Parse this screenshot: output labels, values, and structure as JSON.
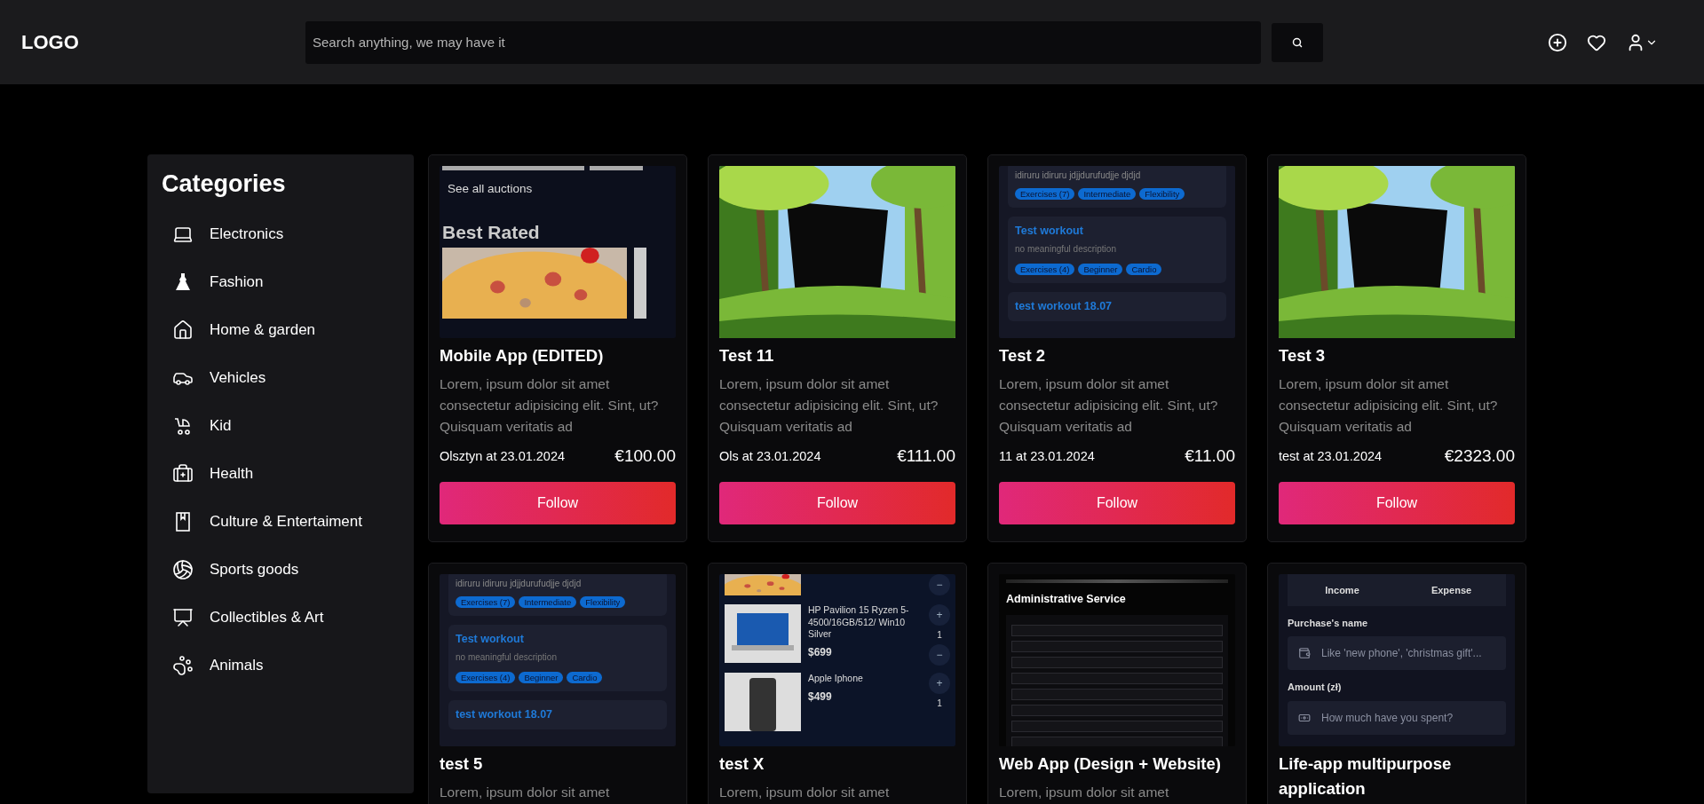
{
  "header": {
    "logo": "LOGO",
    "search": {
      "placeholder": "Search anything, we may have it"
    }
  },
  "sidebar": {
    "title": "Categories",
    "items": [
      {
        "label": "Electronics"
      },
      {
        "label": "Fashion"
      },
      {
        "label": "Home & garden"
      },
      {
        "label": "Vehicles"
      },
      {
        "label": "Kid"
      },
      {
        "label": "Health"
      },
      {
        "label": "Culture & Entertaiment"
      },
      {
        "label": "Sports goods"
      },
      {
        "label": "Collectibles & Art"
      },
      {
        "label": "Animals"
      }
    ]
  },
  "cards": [
    {
      "thumb": {
        "kind": "auction",
        "link": "See all auctions",
        "heading": "Best Rated"
      },
      "title": "Mobile App (EDITED)",
      "description": "Lorem, ipsum dolor sit amet consectetur adipisicing elit. Sint, ut? Quisquam veritatis ad",
      "place": "Olsztyn at 23.01.2024",
      "price": "€100.00",
      "action": "Follow"
    },
    {
      "title": "Test 11",
      "description": "Lorem, ipsum dolor sit amet consectetur adipisicing elit. Sint, ut? Quisquam veritatis ad",
      "place": "Ols at 23.01.2024",
      "price": "€111.00",
      "action": "Follow"
    },
    {
      "thumb": {
        "kind": "workout",
        "top": "idiruru idiruru jdjjdurufudjje djdjd",
        "tags": [
          "Exercises (7)",
          "Intermediate",
          "Flexibility"
        ],
        "items": [
          {
            "title": "Test workout",
            "text": "no meaningful description",
            "tags": [
              "Exercises (4)",
              "Beginner",
              "Cardio"
            ]
          },
          {
            "title": "test workout 18.07"
          }
        ]
      },
      "title": "Test 2",
      "description": "Lorem, ipsum dolor sit amet consectetur adipisicing elit. Sint, ut? Quisquam veritatis ad",
      "place": "11 at 23.01.2024",
      "price": "€11.00",
      "action": "Follow"
    },
    {
      "title": "Test 3",
      "description": "Lorem, ipsum dolor sit amet consectetur adipisicing elit. Sint, ut? Quisquam veritatis ad",
      "place": "test at 23.01.2024",
      "price": "€2323.00",
      "action": "Follow"
    },
    {
      "thumb": {
        "kind": "workout",
        "top": "idiruru idiruru jdjjdurufudjje djdjd",
        "tags": [
          "Exercises (7)",
          "Intermediate",
          "Flexibility"
        ],
        "items": [
          {
            "title": "Test workout",
            "text": "no meaningful description",
            "tags": [
              "Exercises (4)",
              "Beginner",
              "Cardio"
            ]
          },
          {
            "title": "test workout 18.07"
          }
        ]
      },
      "title": "test 5",
      "description": "Lorem, ipsum dolor sit amet"
    },
    {
      "thumb": {
        "kind": "shop",
        "products": [
          {
            "name": "HP Pavilion 15 Ryzen 5-4500/16GB/512/ Win10 Silver",
            "price": "$699",
            "minus": "−",
            "plus": "+",
            "qty": "1"
          },
          {
            "name": "Apple Iphone",
            "price": "$499",
            "plus": "+",
            "qty": "1"
          }
        ],
        "minus": "−"
      },
      "title": "test X",
      "description": "Lorem, ipsum dolor sit amet"
    },
    {
      "thumb": {
        "kind": "admin",
        "heading": "Administrative Service"
      },
      "title": "Web App (Design + Website)",
      "description": "Lorem, ipsum dolor sit amet"
    },
    {
      "thumb": {
        "kind": "finance",
        "tabs": [
          "Income",
          "Expense"
        ],
        "fields": [
          {
            "label": "Purchase's name",
            "placeholder": "Like 'new phone', 'christmas gift'..."
          },
          {
            "label": "Amount (zł)",
            "placeholder": "How much have you spent?"
          }
        ]
      },
      "title": "Life-app multipurpose application"
    }
  ]
}
